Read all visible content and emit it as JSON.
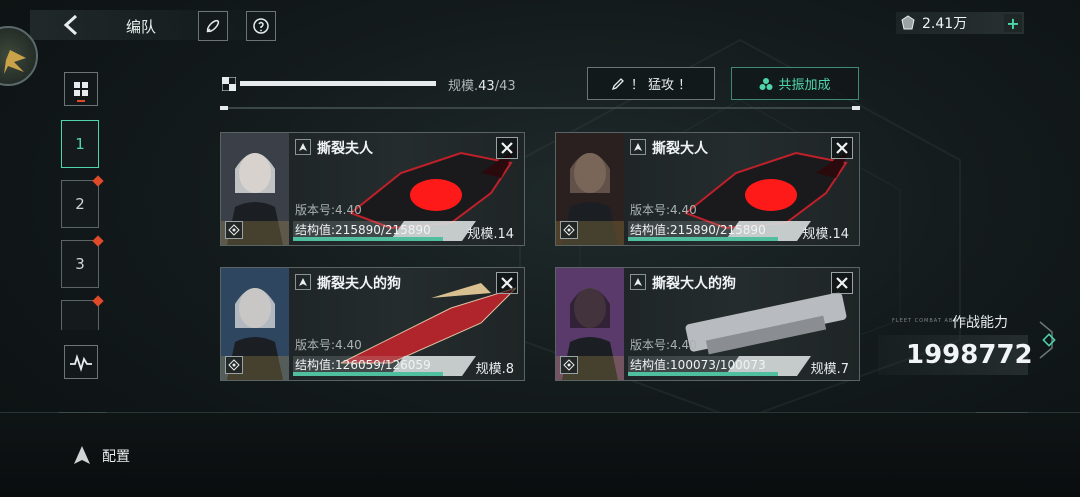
{
  "header": {
    "title": "编队",
    "currency_value": "2.41万",
    "currency_add": "+"
  },
  "slots": {
    "items": [
      {
        "label": "1",
        "active": true,
        "alert": false
      },
      {
        "label": "2",
        "active": false,
        "alert": true
      },
      {
        "label": "3",
        "active": false,
        "alert": true
      }
    ]
  },
  "scale": {
    "label": "规模.",
    "current": "43",
    "separator": "/",
    "max": "43",
    "fraction": 1.0
  },
  "actions": {
    "assault_label": "！ 猛攻 ！",
    "resonance_label": "共振加成"
  },
  "ships": [
    {
      "name": "撕裂夫人",
      "version": "版本号:4.40",
      "hp": "结构值:215890/215890",
      "hp_fraction": 1.0,
      "level": "规模.14"
    },
    {
      "name": "撕裂大人",
      "version": "版本号:4.40",
      "hp": "结构值:215890/215890",
      "hp_fraction": 1.0,
      "level": "规模.14"
    },
    {
      "name": "撕裂夫人的狗",
      "version": "版本号:4.40",
      "hp": "结构值:126059/126059",
      "hp_fraction": 1.0,
      "level": "规模.8"
    },
    {
      "name": "撕裂大人的狗",
      "version": "版本号:4.40",
      "hp": "结构值:100073/100073",
      "hp_fraction": 1.0,
      "level": "规模.7"
    }
  ],
  "combat": {
    "label": "作战能力",
    "value": "1998772",
    "tag": "FLEET COMBAT ABILITY"
  },
  "footer": {
    "config_label": "配置"
  },
  "colors": {
    "accent": "#4fd6a8",
    "alert": "#e04a2a"
  }
}
